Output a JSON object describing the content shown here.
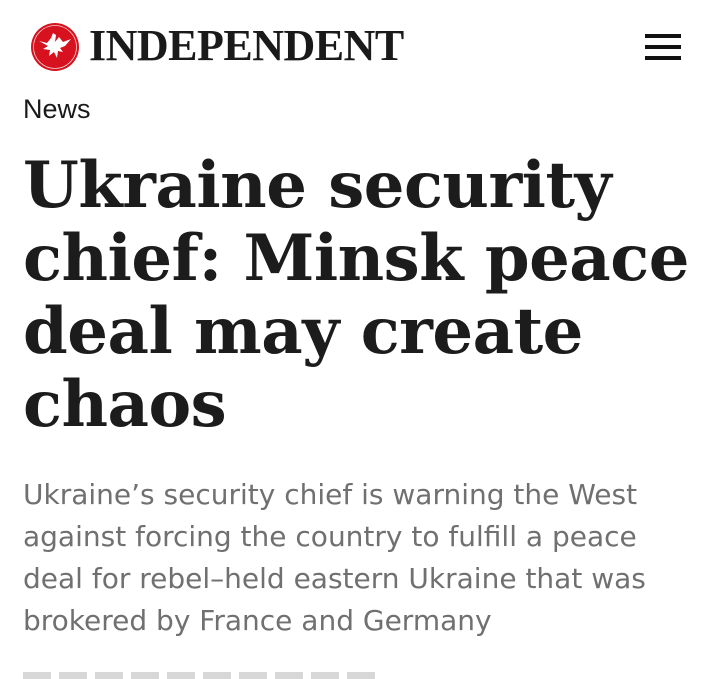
{
  "header": {
    "logo_text": "INDEPENDENT",
    "logo_icon": "eagle-icon",
    "menu_icon": "hamburger-menu-icon"
  },
  "article": {
    "section": "News",
    "headline": "Ukraine security chief: Minsk peace deal may create chaos",
    "standfirst": "Ukraine’s security chief is warning the West against forcing the country to fulfill a peace deal for rebel–held eastern Ukraine that was brokered by France and Germany"
  },
  "colors": {
    "brand_red": "#d7111d",
    "text_dark": "#1c1c1c",
    "standfirst_grey": "#707070",
    "background": "#ffffff"
  }
}
